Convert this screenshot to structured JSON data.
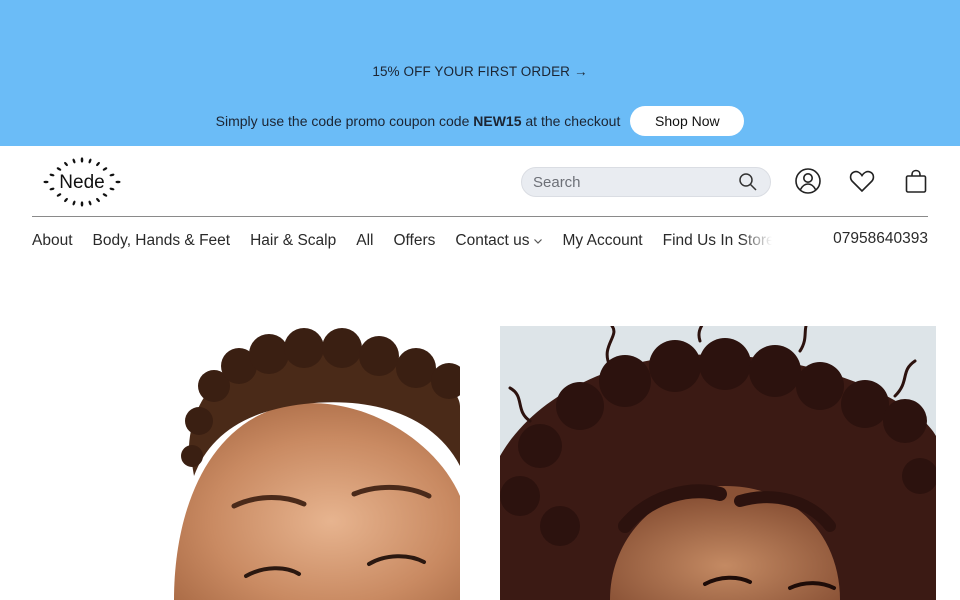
{
  "promo": {
    "headline": "15% OFF YOUR FIRST ORDER",
    "arrow": "→",
    "text_before": "Simply use the code promo coupon code ",
    "code": "NEW15",
    "text_after": " at the checkout",
    "cta": "Shop Now",
    "background": "#6bbcf7"
  },
  "brand": {
    "name": "Nede",
    "logo_icon": "sunburst-logo"
  },
  "search": {
    "placeholder": "Search",
    "icon": "search-icon"
  },
  "header_icons": [
    "account-icon",
    "heart-icon",
    "shopping-bag-icon"
  ],
  "nav": {
    "items": [
      {
        "label": "About"
      },
      {
        "label": "Body, Hands & Feet"
      },
      {
        "label": "Hair & Scalp"
      },
      {
        "label": "All"
      },
      {
        "label": "Offers"
      },
      {
        "label": "Contact us",
        "has_dropdown": true
      },
      {
        "label": "My Account"
      },
      {
        "label": "Find Us In Store"
      }
    ],
    "phone": "07958640393"
  },
  "hero": {
    "cards": [
      {
        "subject": "woman-smiling-curly-hair"
      },
      {
        "subject": "woman-voluminous-curly-hair"
      }
    ]
  }
}
